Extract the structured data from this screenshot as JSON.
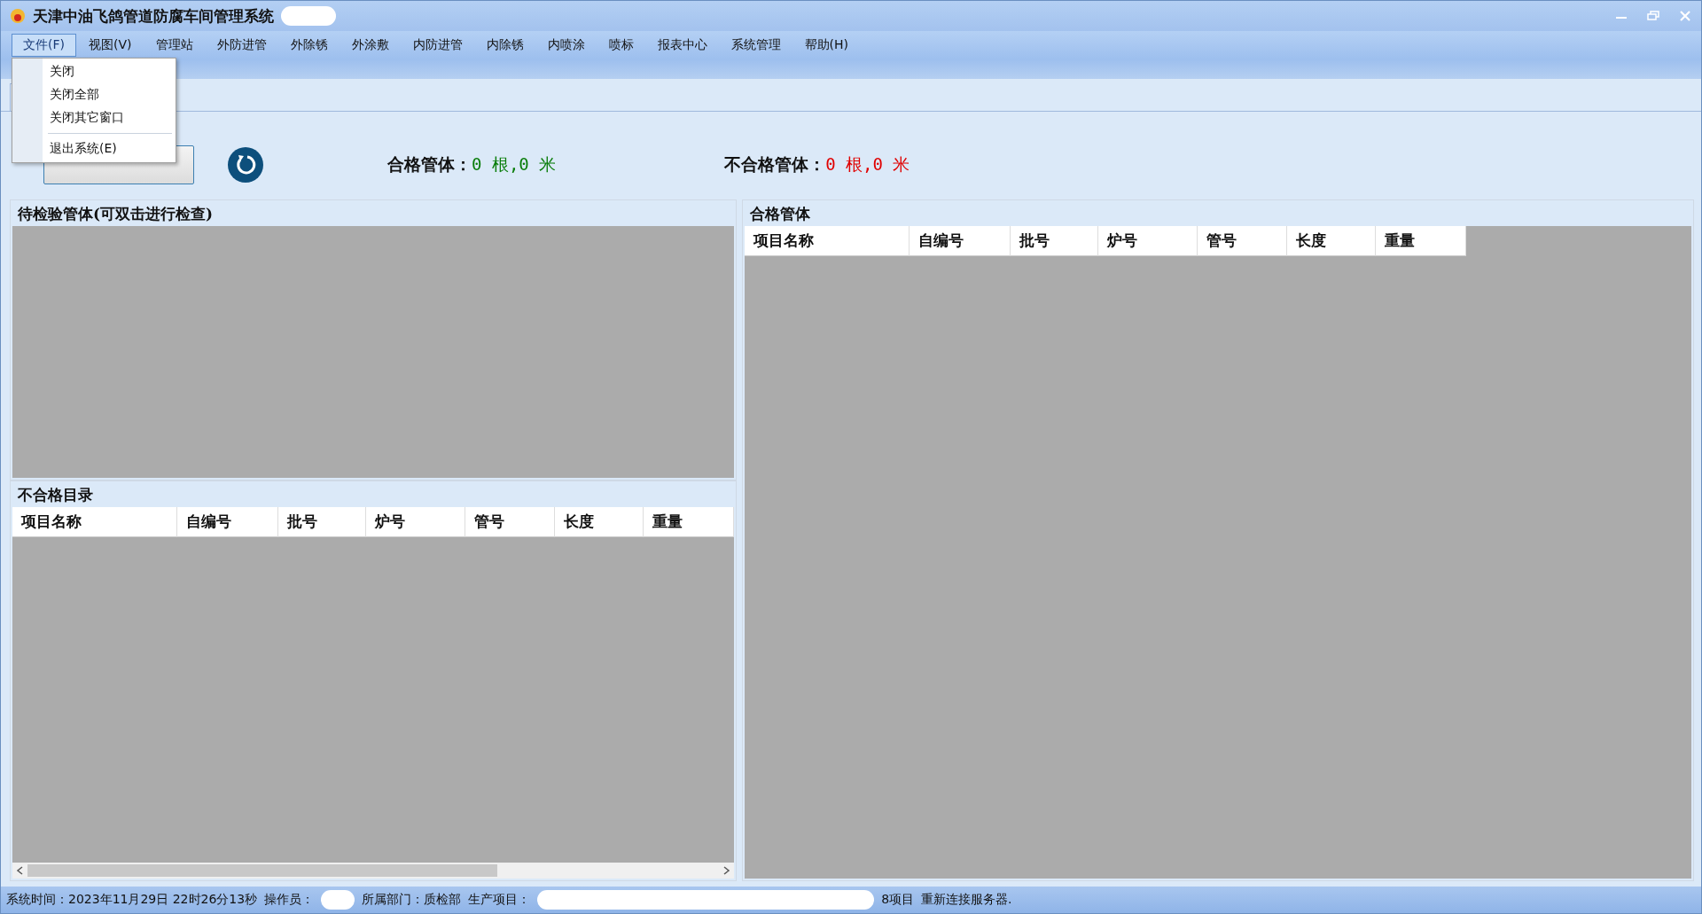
{
  "window": {
    "title": "天津中油飞鸽管道防腐车间管理系统"
  },
  "menu": [
    {
      "label": "文件(F)",
      "selected": true
    },
    {
      "label": "视图(V)",
      "selected": false
    },
    {
      "label": "管理站",
      "selected": false
    },
    {
      "label": "外防进管",
      "selected": false
    },
    {
      "label": "外除锈",
      "selected": false
    },
    {
      "label": "外涂敷",
      "selected": false
    },
    {
      "label": "内防进管",
      "selected": false
    },
    {
      "label": "内除锈",
      "selected": false
    },
    {
      "label": "内喷涂",
      "selected": false
    },
    {
      "label": "喷标",
      "selected": false
    },
    {
      "label": "报表中心",
      "selected": false
    },
    {
      "label": "系统管理",
      "selected": false
    },
    {
      "label": "帮助(H)",
      "selected": false
    }
  ],
  "file_menu": [
    {
      "kind": "item",
      "label": "关闭"
    },
    {
      "kind": "item",
      "label": "关闭全部"
    },
    {
      "kind": "item",
      "label": "关闭其它窗口"
    },
    {
      "kind": "separator"
    },
    {
      "kind": "item",
      "label": "退出系统(E)"
    }
  ],
  "summary": [
    {
      "kind": "pass",
      "label": "合格管体：",
      "value": "0 根,0 米"
    },
    {
      "kind": "fail",
      "label": "不合格管体：",
      "value": "0 根,0 米"
    }
  ],
  "pending_panel": {
    "title": "待检验管体(可双击进行检查)"
  },
  "rejected_panel": {
    "title": "不合格目录",
    "columns": [
      "项目名称",
      "自编号",
      "批号",
      "炉号",
      "管号",
      "长度",
      "重量"
    ]
  },
  "qualified_panel": {
    "title": "合格管体",
    "columns": [
      "项目名称",
      "自编号",
      "批号",
      "炉号",
      "管号",
      "长度",
      "重量"
    ]
  },
  "status_bar": [
    {
      "kind": "text",
      "text": "系统时间：2023年11月29日 22时26分13秒"
    },
    {
      "kind": "text",
      "text": "操作员："
    },
    {
      "kind": "redacted"
    },
    {
      "kind": "text",
      "text": "所属部门：质检部"
    },
    {
      "kind": "text",
      "text": "生产项目："
    },
    {
      "kind": "redacted"
    },
    {
      "kind": "text",
      "text": "8项目"
    },
    {
      "kind": "text",
      "text": "重新连接服务器."
    }
  ]
}
